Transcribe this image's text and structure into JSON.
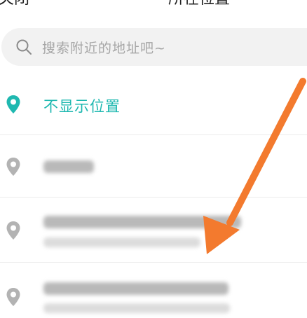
{
  "header": {
    "close_label": "关闭",
    "title": "所在位置"
  },
  "search": {
    "placeholder": "搜索附近的地址吧~"
  },
  "locations": [
    {
      "label": "不显示位置",
      "state": "selected",
      "icon": "location-pin-icon"
    },
    {
      "label": "",
      "state": "obscured",
      "icon": "location-pin-icon"
    },
    {
      "label": "",
      "state": "obscured",
      "icon": "location-pin-icon"
    },
    {
      "label": "",
      "state": "obscured",
      "icon": "location-pin-icon"
    }
  ],
  "colors": {
    "accent": "#1fb8b0",
    "pin_inactive": "#b3b3b3",
    "arrow": "#f37a2e",
    "search_bg": "#f2f2f2"
  }
}
